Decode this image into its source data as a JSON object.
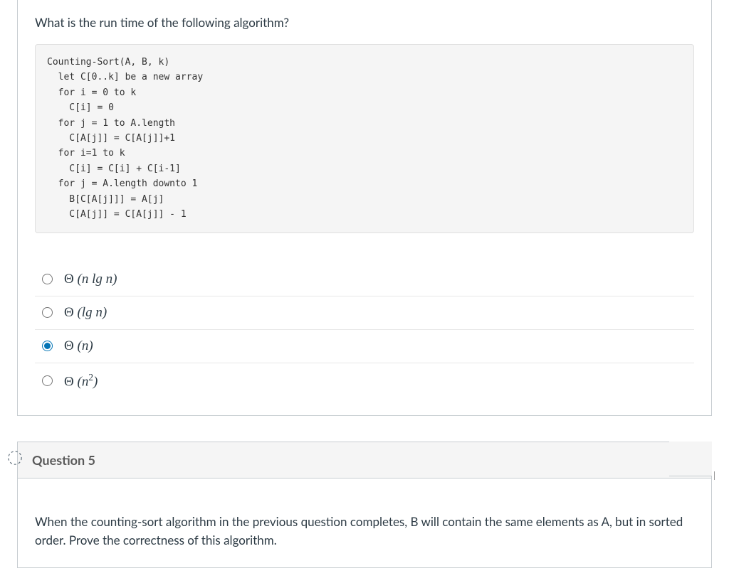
{
  "question4": {
    "prompt": "What is the run time of the following algorithm?",
    "code": "Counting-Sort(A, B, k)\n  let C[0..k] be a new array\n  for i = 0 to k\n    C[i] = 0\n  for j = 1 to A.length\n    C[A[j]] = C[A[j]]+1\n  for i=1 to k\n    C[i] = C[i] + C[i-1]\n  for j = A.length downto 1\n    B[C[A[j]]] = A[j]\n    C[A[j]] = C[A[j]] - 1",
    "options": [
      {
        "html": "Θ (n lg n)",
        "selected": false
      },
      {
        "html": "Θ (lg n)",
        "selected": false
      },
      {
        "html": "Θ (n)",
        "selected": true
      },
      {
        "html": "Θ (n²)",
        "selected": false
      }
    ]
  },
  "question5": {
    "title": "Question 5",
    "prompt": "When the counting-sort algorithm in the previous question completes, B will contain the same elements as A, but in sorted order.  Prove the correctness of this algorithm.",
    "status": "unanswered"
  }
}
